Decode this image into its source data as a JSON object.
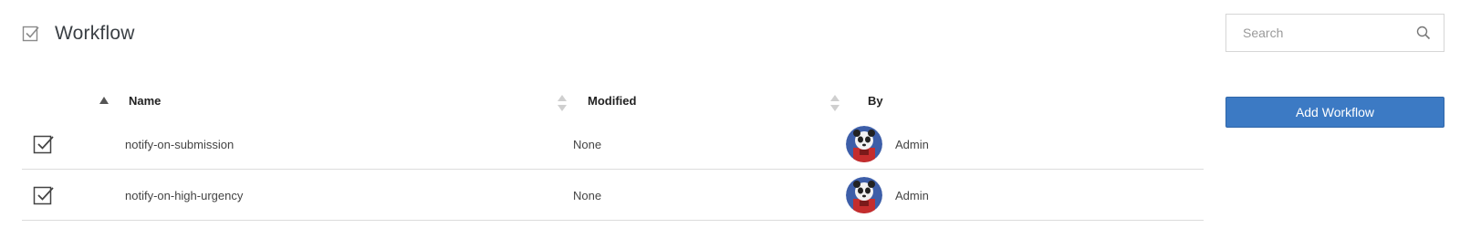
{
  "header": {
    "icon": "checkbox-checked-icon",
    "title": "Workflow"
  },
  "search": {
    "placeholder": "Search",
    "value": "",
    "icon": "search-icon"
  },
  "actions": {
    "add_label": "Add Workflow",
    "add_color": "#3c7ac4"
  },
  "table": {
    "columns": {
      "name": "Name",
      "modified": "Modified",
      "by": "By"
    },
    "sort": {
      "column": "Name",
      "direction": "ascending"
    },
    "rows": [
      {
        "name": "notify-on-submission",
        "modified": "None",
        "by": "Admin",
        "icon": "checkbox-checked-icon",
        "avatar": "panda-robot-avatar"
      },
      {
        "name": "notify-on-high-urgency",
        "modified": "None",
        "by": "Admin",
        "icon": "checkbox-checked-icon",
        "avatar": "panda-robot-avatar"
      }
    ]
  }
}
